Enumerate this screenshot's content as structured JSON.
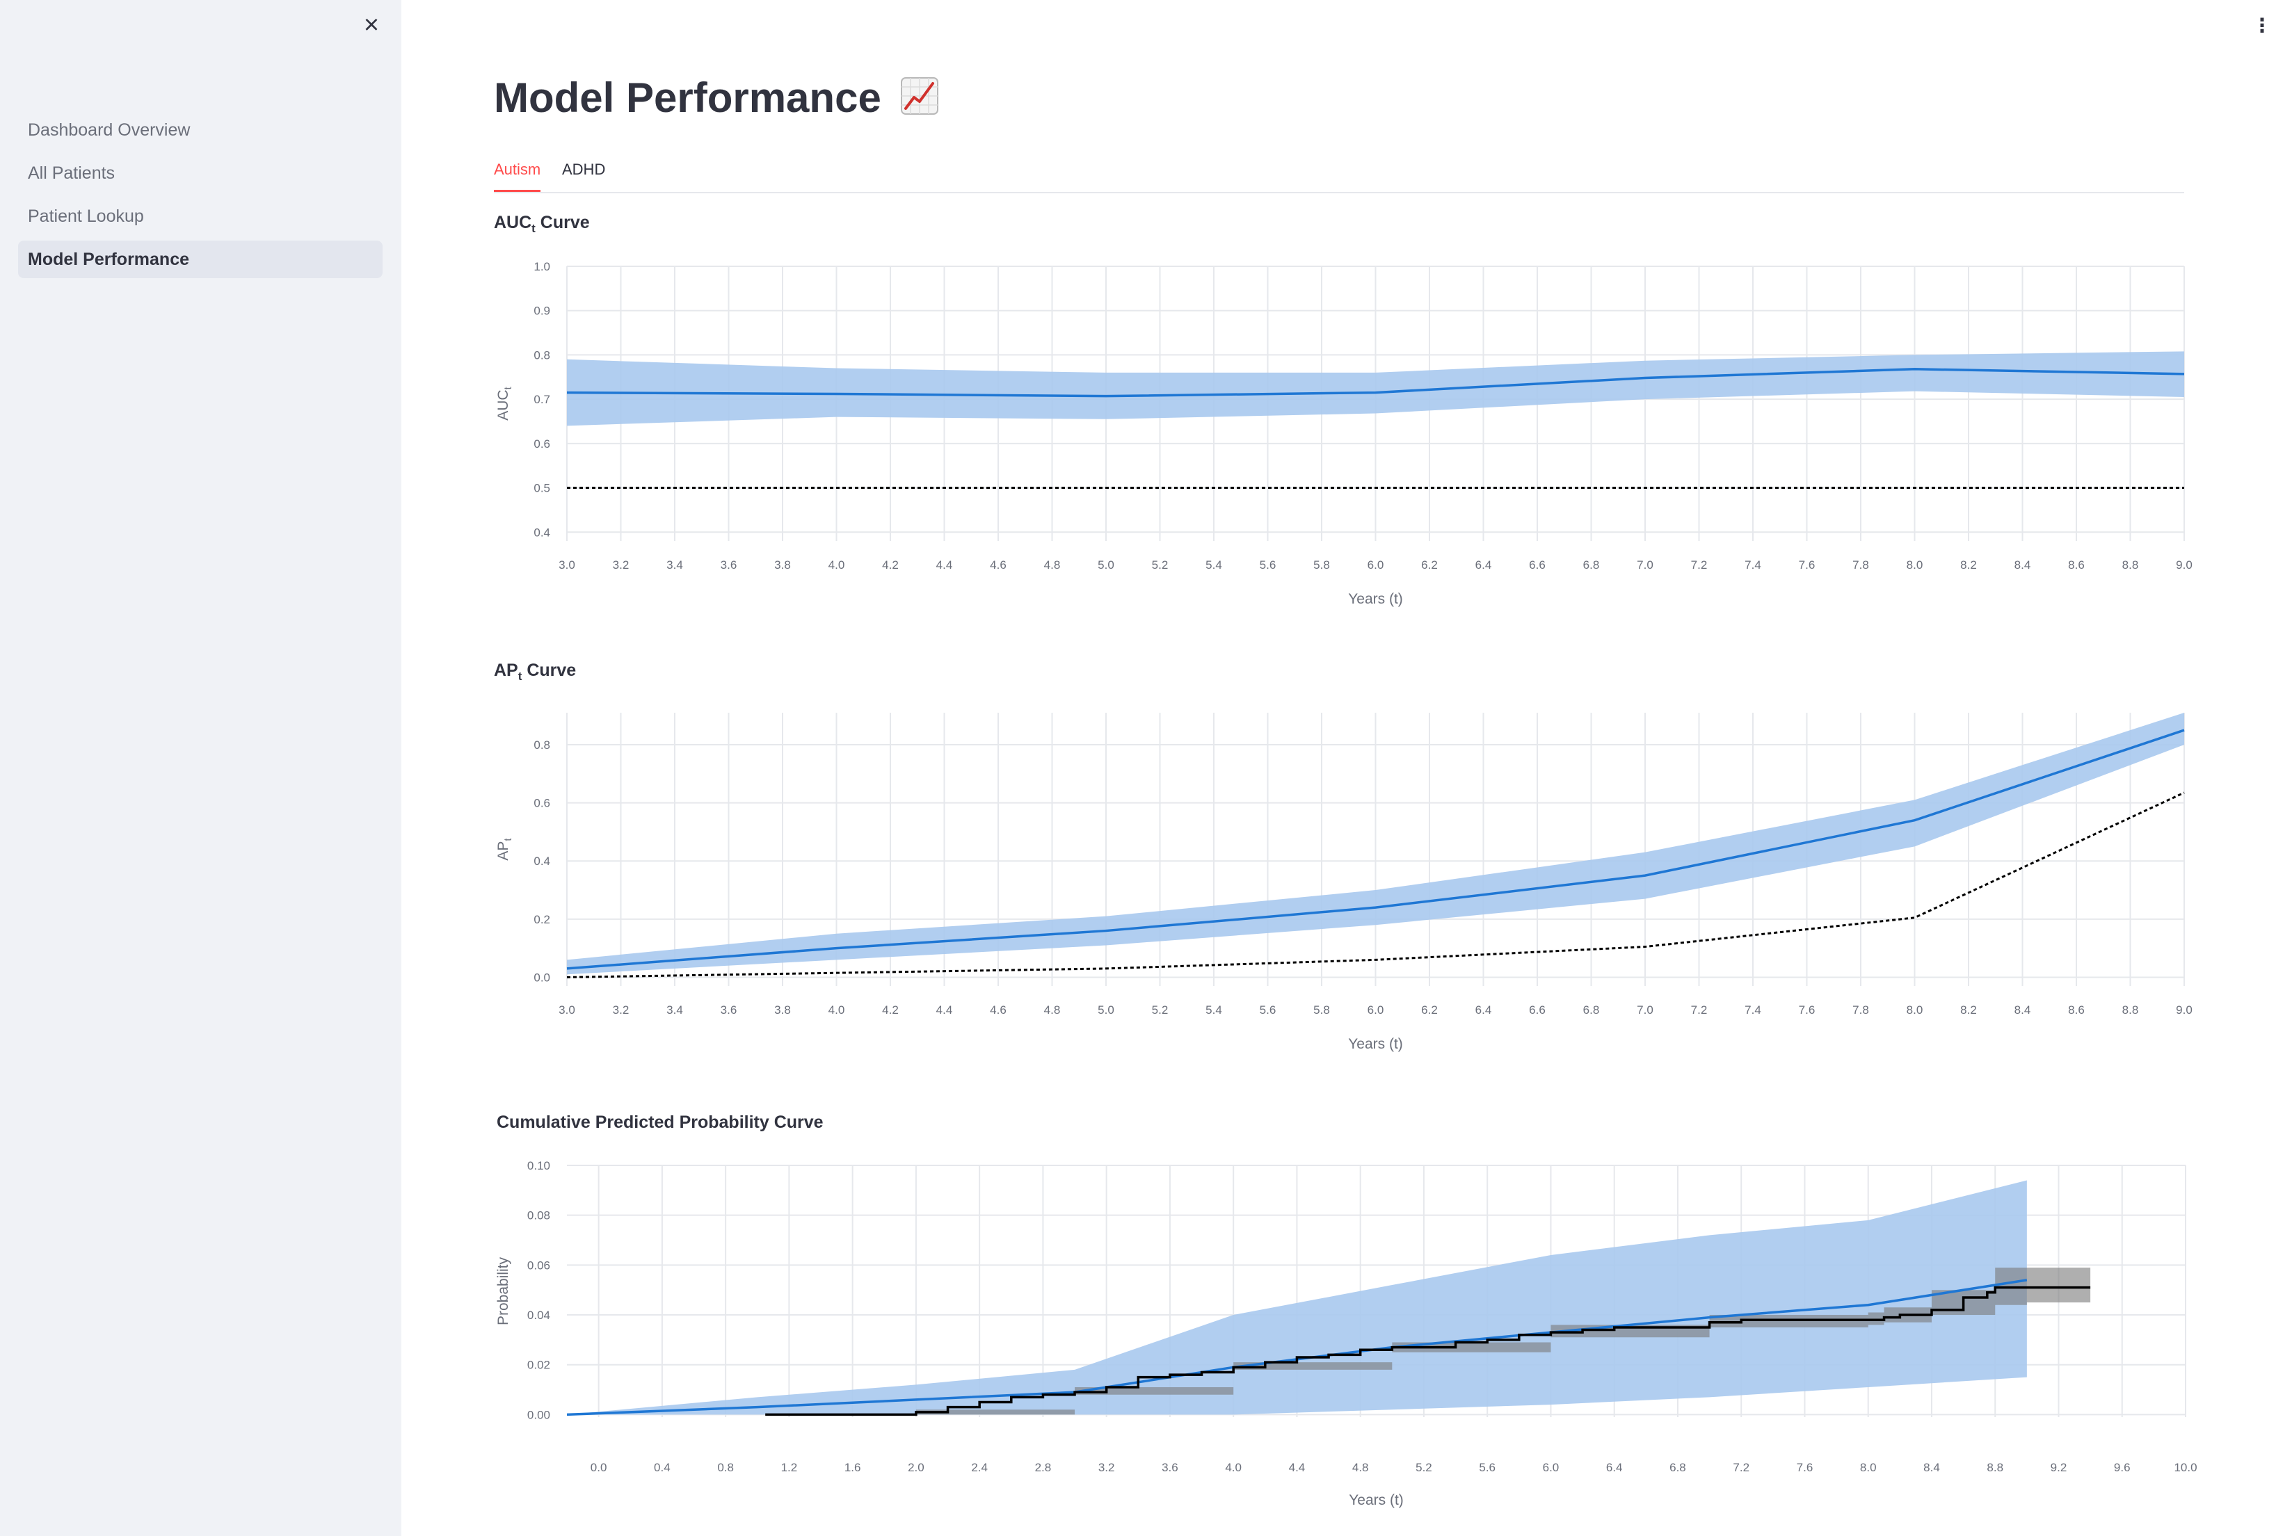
{
  "sidebar": {
    "close_icon": "×",
    "items": [
      {
        "label": "Dashboard Overview",
        "active": false
      },
      {
        "label": "All Patients",
        "active": false
      },
      {
        "label": "Patient Lookup",
        "active": false
      },
      {
        "label": "Model Performance",
        "active": true
      }
    ]
  },
  "header": {
    "menu_icon": "⋮"
  },
  "page": {
    "title": "Model Performance",
    "title_icon": "chart-increasing-icon",
    "tabs": [
      {
        "label": "Autism",
        "active": true
      },
      {
        "label": "ADHD",
        "active": false
      }
    ]
  },
  "colors": {
    "accent": "#ff4b4b",
    "line": "#1f77d4",
    "band": "#a9c9ee",
    "reference": "#000000",
    "grid": "#e6e8ec"
  },
  "chart_data": [
    {
      "type": "line",
      "title_main": "AUC",
      "title_sub": "t",
      "title_rest": " Curve",
      "ylabel_main": "AUC",
      "ylabel_sub": "t",
      "xlabel": "Years (t)",
      "xlim": [
        3.0,
        9.0
      ],
      "ylim": [
        0.38,
        1.0
      ],
      "xticks": [
        3.0,
        3.2,
        3.4,
        3.6,
        3.8,
        4.0,
        4.2,
        4.4,
        4.6,
        4.8,
        5.0,
        5.2,
        5.4,
        5.6,
        5.8,
        6.0,
        6.2,
        6.4,
        6.6,
        6.8,
        7.0,
        7.2,
        7.4,
        7.6,
        7.8,
        8.0,
        8.2,
        8.4,
        8.6,
        8.8,
        9.0
      ],
      "yticks": [
        0.4,
        0.5,
        0.6,
        0.7,
        0.8,
        0.9,
        1.0
      ],
      "grid": true,
      "series": [
        {
          "role": "estimate",
          "x": [
            3,
            4,
            5,
            6,
            7,
            8,
            9
          ],
          "y": [
            0.715,
            0.712,
            0.707,
            0.715,
            0.748,
            0.768,
            0.757
          ]
        },
        {
          "role": "ci",
          "x": [
            3,
            4,
            5,
            6,
            7,
            8,
            9
          ],
          "lower": [
            0.64,
            0.66,
            0.655,
            0.668,
            0.7,
            0.718,
            0.705
          ],
          "upper": [
            0.79,
            0.77,
            0.76,
            0.76,
            0.787,
            0.8,
            0.808
          ]
        },
        {
          "role": "reference",
          "x": [
            3,
            9
          ],
          "y": [
            0.5,
            0.5
          ]
        }
      ]
    },
    {
      "type": "line",
      "title_main": "AP",
      "title_sub": "t",
      "title_rest": " Curve",
      "ylabel_main": "AP",
      "ylabel_sub": "t",
      "xlabel": "Years (t)",
      "xlim": [
        3.0,
        9.0
      ],
      "ylim": [
        -0.03,
        0.91
      ],
      "xticks": [
        3.0,
        3.2,
        3.4,
        3.6,
        3.8,
        4.0,
        4.2,
        4.4,
        4.6,
        4.8,
        5.0,
        5.2,
        5.4,
        5.6,
        5.8,
        6.0,
        6.2,
        6.4,
        6.6,
        6.8,
        7.0,
        7.2,
        7.4,
        7.6,
        7.8,
        8.0,
        8.2,
        8.4,
        8.6,
        8.8,
        9.0
      ],
      "yticks": [
        0.0,
        0.2,
        0.4,
        0.6,
        0.8
      ],
      "grid": true,
      "series": [
        {
          "role": "estimate",
          "x": [
            3,
            4,
            5,
            6,
            7,
            8,
            9
          ],
          "y": [
            0.03,
            0.1,
            0.16,
            0.24,
            0.35,
            0.54,
            0.85
          ]
        },
        {
          "role": "ci",
          "x": [
            3,
            4,
            5,
            6,
            7,
            8,
            9
          ],
          "lower": [
            0.01,
            0.06,
            0.11,
            0.18,
            0.27,
            0.45,
            0.8
          ],
          "upper": [
            0.06,
            0.15,
            0.21,
            0.3,
            0.43,
            0.61,
            0.91
          ]
        },
        {
          "role": "reference",
          "x": [
            3,
            4,
            5,
            6,
            7,
            8,
            9
          ],
          "y": [
            0.0,
            0.015,
            0.03,
            0.06,
            0.105,
            0.205,
            0.635
          ]
        }
      ]
    },
    {
      "type": "line",
      "title_main": "Cumulative Predicted Probability Curve",
      "title_sub": "",
      "title_rest": "",
      "ylabel_main": "Probability",
      "ylabel_sub": "",
      "xlabel": "Years (t)",
      "xlim": [
        -0.2,
        10.0
      ],
      "ylim": [
        -0.001,
        0.1
      ],
      "xticks": [
        0.0,
        0.4,
        0.8,
        1.2,
        1.6,
        2.0,
        2.4,
        2.8,
        3.2,
        3.6,
        4.0,
        4.4,
        4.8,
        5.2,
        5.6,
        6.0,
        6.4,
        6.8,
        7.2,
        7.6,
        8.0,
        8.4,
        8.8,
        9.2,
        9.6,
        10.0
      ],
      "yticks": [
        0.0,
        0.02,
        0.04,
        0.06,
        0.08,
        0.1
      ],
      "yticklabels": [
        "0.00",
        "0.02",
        "0.04",
        "0.06",
        "0.08",
        "0.10"
      ],
      "grid": true,
      "series": [
        {
          "role": "estimate",
          "x": [
            -0.2,
            1.0,
            2.0,
            3.0,
            4.0,
            5.0,
            6.0,
            7.0,
            8.0,
            9.0
          ],
          "y": [
            0.0,
            0.003,
            0.006,
            0.009,
            0.019,
            0.027,
            0.033,
            0.039,
            0.044,
            0.054
          ]
        },
        {
          "role": "ci",
          "x": [
            -0.2,
            1.0,
            2.0,
            3.0,
            4.0,
            5.0,
            6.0,
            7.0,
            8.0,
            9.0
          ],
          "lower": [
            0.0,
            0.0,
            0.0,
            0.0,
            0.0,
            0.002,
            0.004,
            0.007,
            0.011,
            0.015
          ],
          "upper": [
            0.0,
            0.007,
            0.012,
            0.018,
            0.04,
            0.052,
            0.064,
            0.072,
            0.078,
            0.094
          ]
        },
        {
          "role": "observed",
          "x": [
            1.05,
            1.6,
            2.0,
            2.2,
            2.4,
            2.6,
            2.8,
            3.0,
            3.2,
            3.4,
            3.6,
            3.8,
            4.0,
            4.2,
            4.4,
            4.6,
            4.8,
            5.0,
            5.2,
            5.4,
            5.6,
            5.8,
            6.0,
            6.2,
            6.4,
            6.6,
            6.8,
            7.0,
            7.2,
            7.4,
            7.6,
            7.8,
            8.0,
            8.1,
            8.2,
            8.4,
            8.6,
            8.75,
            8.8,
            9.0,
            9.4
          ],
          "y": [
            0.0,
            0.0,
            0.001,
            0.003,
            0.005,
            0.007,
            0.008,
            0.009,
            0.011,
            0.015,
            0.016,
            0.017,
            0.019,
            0.021,
            0.023,
            0.024,
            0.026,
            0.027,
            0.027,
            0.029,
            0.03,
            0.032,
            0.033,
            0.034,
            0.035,
            0.035,
            0.035,
            0.037,
            0.038,
            0.038,
            0.038,
            0.038,
            0.038,
            0.039,
            0.04,
            0.042,
            0.047,
            0.049,
            0.051,
            0.051,
            0.051
          ]
        },
        {
          "role": "observed_band",
          "x": [
            1.05,
            2.0,
            3.0,
            4.0,
            5.0,
            6.0,
            7.0,
            8.0,
            8.1,
            8.4,
            8.8,
            9.0,
            9.4
          ],
          "lower": [
            0.0,
            0.0,
            0.008,
            0.018,
            0.025,
            0.031,
            0.035,
            0.036,
            0.037,
            0.04,
            0.044,
            0.045,
            0.045
          ],
          "upper": [
            0.0,
            0.002,
            0.011,
            0.021,
            0.029,
            0.036,
            0.04,
            0.041,
            0.043,
            0.05,
            0.059,
            0.059,
            0.059
          ]
        }
      ]
    }
  ]
}
